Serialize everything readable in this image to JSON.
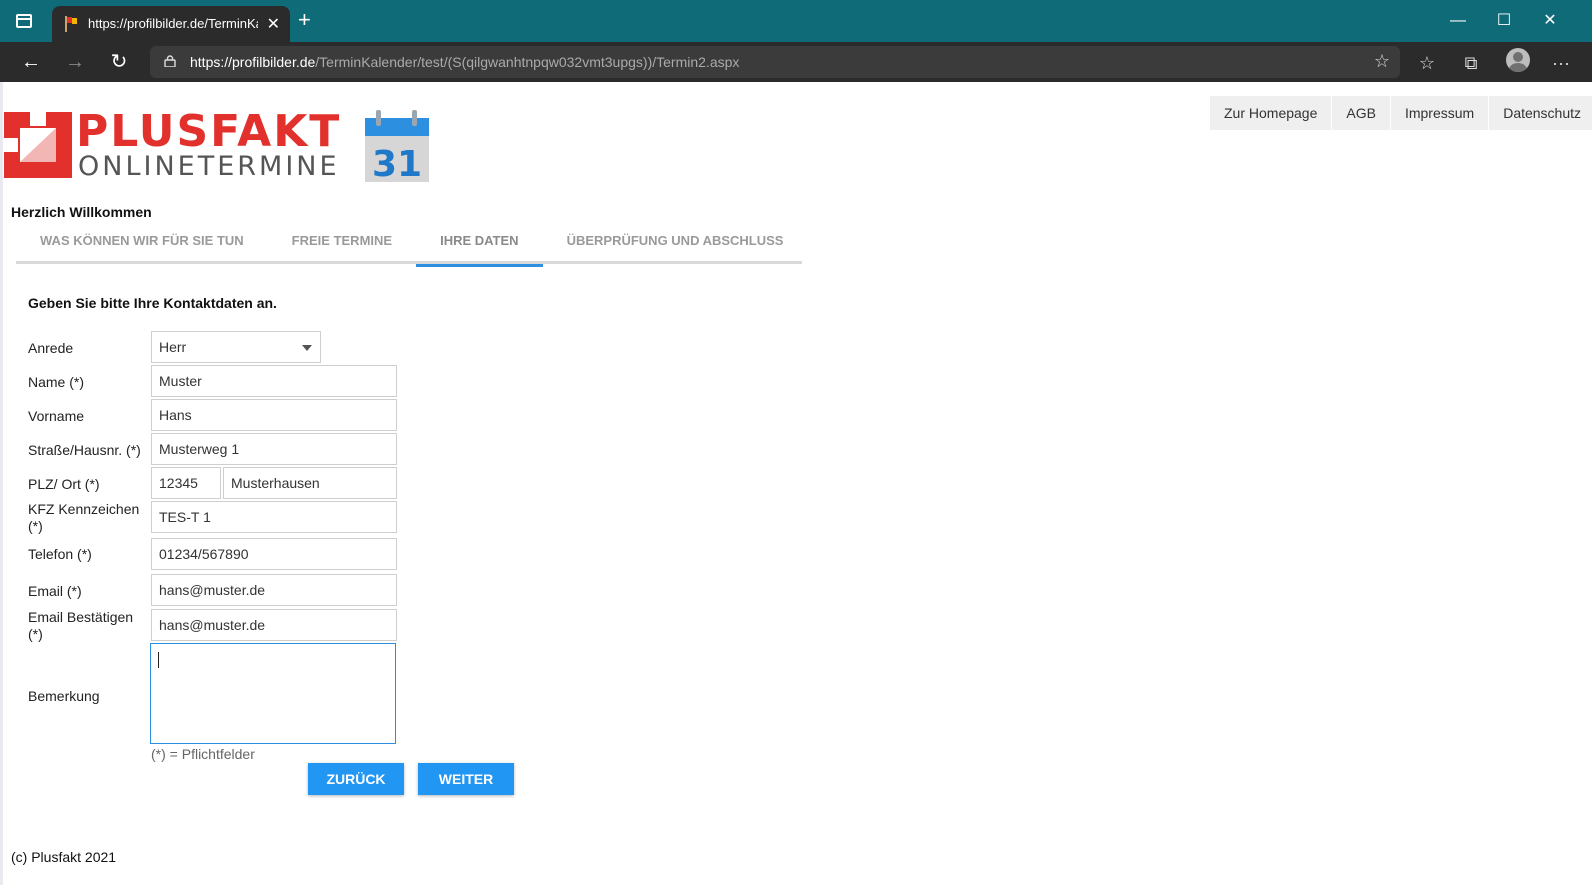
{
  "browser": {
    "tab_title": "https://profilbilder.de/TerminKalender/test/",
    "close_tab": "✕",
    "new_tab": "+",
    "url_host": "https://profilbilder.de",
    "url_path": "/TerminKalender/test/(S(qilgwanhtnpqw032vmt3upgs))/Termin2.aspx",
    "window_minimize": "—",
    "window_maximize": "☐",
    "window_close": "✕",
    "back": "←",
    "forward": "→",
    "refresh": "↻",
    "more": "···"
  },
  "logo": {
    "line1": "PLUSFAKT",
    "line2": "ONLINETERMINE",
    "calendar_day": "31"
  },
  "topnav": [
    "Zur Homepage",
    "AGB",
    "Impressum",
    "Datenschutz"
  ],
  "welcome": "Herzlich Willkommen",
  "steps": [
    {
      "label": "WAS KÖNNEN WIR FÜR SIE TUN"
    },
    {
      "label": "FREIE TERMINE"
    },
    {
      "label": "IHRE DATEN",
      "active": true
    },
    {
      "label": "ÜBERPRÜFUNG UND ABSCHLUSS"
    }
  ],
  "form": {
    "instruction": "Geben Sie bitte Ihre Kontaktdaten an.",
    "anrede_label": "Anrede",
    "anrede_value": "Herr",
    "name_label": "Name (*)",
    "name_value": "Muster",
    "vorname_label": "Vorname",
    "vorname_value": "Hans",
    "strasse_label": "Straße/Hausnr. (*)",
    "strasse_value": "Musterweg 1",
    "plz_label": "PLZ/ Ort (*)",
    "plz_value": "12345",
    "ort_value": "Musterhausen",
    "kfz_label_1": "KFZ Kennzeichen",
    "kfz_label_2": "(*)",
    "kfz_value": "TES-T 1",
    "telefon_label": "Telefon (*)",
    "telefon_value": "01234/567890",
    "email_label": "Email (*)",
    "email_value": "hans@muster.de",
    "email_confirm_label_1": "Email Bestätigen",
    "email_confirm_label_2": "(*)",
    "email_confirm_value": "hans@muster.de",
    "bemerkung_label": "Bemerkung",
    "bemerkung_value": "",
    "required_note": "(*) = Pflichtfelder",
    "back_button": "ZURÜCK",
    "next_button": "WEITER"
  },
  "footer": "(c) Plusfakt 2021"
}
